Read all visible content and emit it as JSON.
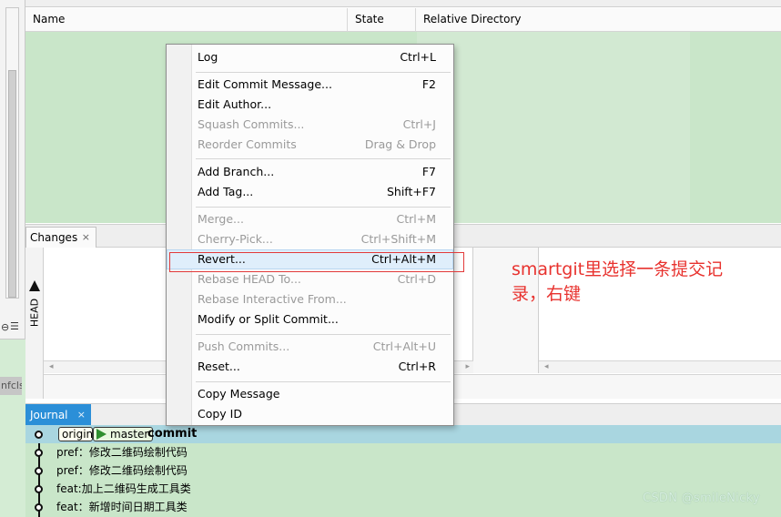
{
  "left_panel": {
    "truncated_label": "nfcls",
    "icons": [
      "hide-icon",
      "menu-icon"
    ]
  },
  "files_table": {
    "columns": [
      "Name",
      "State",
      "Relative Directory"
    ]
  },
  "changes_panel": {
    "tab_label": "Changes",
    "side_label": "HEAD"
  },
  "journal": {
    "tab_label": "Journal",
    "rows": [
      {
        "origin_ref": "origin",
        "master_ref": "master",
        "message": "commit"
      },
      {
        "message": "pref：修改二维码绘制代码"
      },
      {
        "message": "pref：修改二维码绘制代码"
      },
      {
        "message": "feat:加上二维码生成工具类"
      },
      {
        "message": "feat：新增时间日期工具类"
      }
    ]
  },
  "context_menu": {
    "items": [
      {
        "label": "Log",
        "shortcut": "Ctrl+L",
        "enabled": true
      },
      {
        "label": "Edit Commit Message...",
        "shortcut": "F2",
        "enabled": true
      },
      {
        "label": "Edit Author...",
        "shortcut": "",
        "enabled": true
      },
      {
        "label": "Squash Commits...",
        "shortcut": "Ctrl+J",
        "enabled": false
      },
      {
        "label": "Reorder Commits",
        "shortcut": "Drag & Drop",
        "enabled": false
      },
      {
        "label": "Add Branch...",
        "shortcut": "F7",
        "enabled": true
      },
      {
        "label": "Add Tag...",
        "shortcut": "Shift+F7",
        "enabled": true
      },
      {
        "label": "Merge...",
        "shortcut": "Ctrl+M",
        "enabled": false
      },
      {
        "label": "Cherry-Pick...",
        "shortcut": "Ctrl+Shift+M",
        "enabled": false
      },
      {
        "label": "Revert...",
        "shortcut": "Ctrl+Alt+M",
        "enabled": true,
        "highlighted": true
      },
      {
        "label": "Rebase HEAD To...",
        "shortcut": "Ctrl+D",
        "enabled": false
      },
      {
        "label": "Rebase Interactive From...",
        "shortcut": "",
        "enabled": false
      },
      {
        "label": "Modify or Split Commit...",
        "shortcut": "",
        "enabled": true
      },
      {
        "label": "Push Commits...",
        "shortcut": "Ctrl+Alt+U",
        "enabled": false
      },
      {
        "label": "Reset...",
        "shortcut": "Ctrl+R",
        "enabled": true
      },
      {
        "label": "Copy Message",
        "shortcut": "",
        "enabled": true
      },
      {
        "label": "Copy ID",
        "shortcut": "",
        "enabled": true
      }
    ]
  },
  "annotation": {
    "line1": "smartgit里选择一条提交记",
    "line2": "录，右键",
    "color": "#e8322e"
  },
  "watermark": "CSDN @smileNicky",
  "colors": {
    "table_green": "#c9e6c9",
    "journal_selected": "#a9d6e0",
    "journal_tab": "#2b8fd8",
    "branch_arrow": "#2f8f2f"
  }
}
